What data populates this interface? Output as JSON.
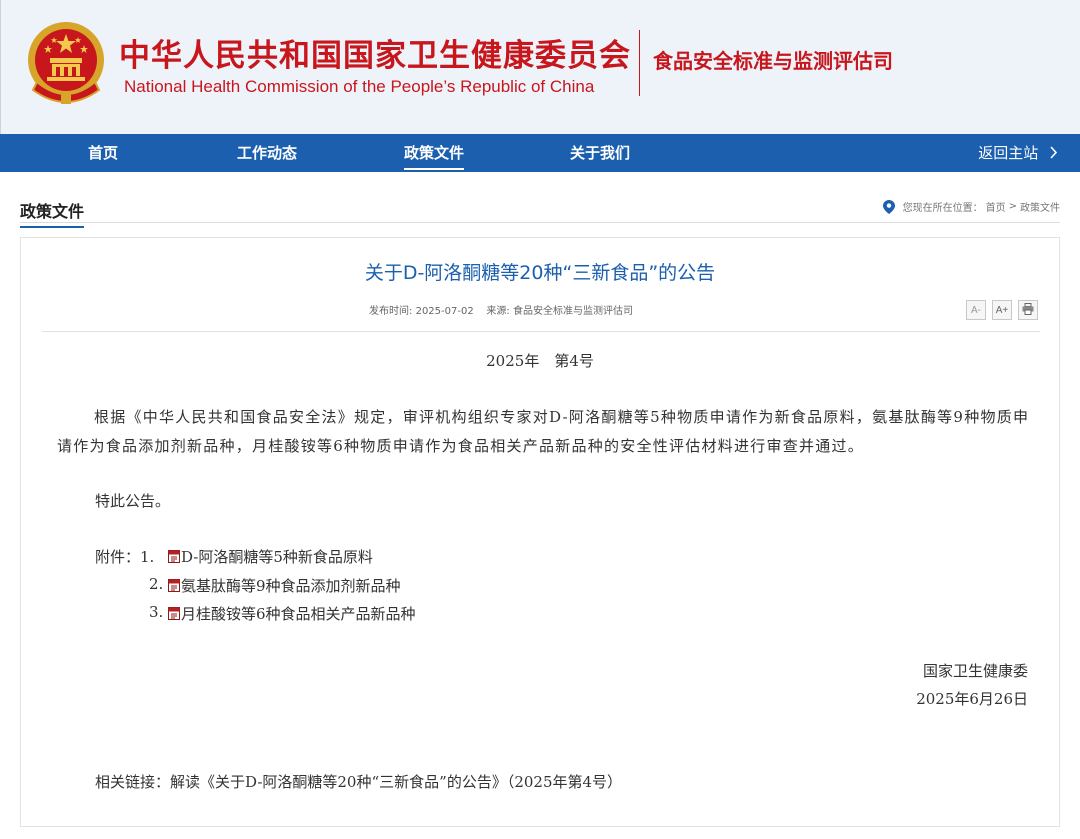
{
  "header": {
    "site_name_cn": "中华人民共和国国家卫生健康委员会",
    "site_name_en": "National Health Commission of the People’s  Republic of China",
    "department": "食品安全标准与监测评估司"
  },
  "nav": {
    "items": [
      {
        "label": "首页",
        "active": false
      },
      {
        "label": "工作动态",
        "active": false
      },
      {
        "label": "政策文件",
        "active": true
      },
      {
        "label": "关于我们",
        "active": false
      }
    ],
    "back_label": "返回主站"
  },
  "section": {
    "title": "政策文件",
    "breadcrumb_prefix": "您现在所在位置：",
    "breadcrumb_home": "首页",
    "breadcrumb_sep": ">",
    "breadcrumb_current": "政策文件"
  },
  "article": {
    "title": "关于D-阿洛酮糖等20种“三新食品”的公告",
    "meta_date_label": "发布时间:",
    "meta_date": "2025-07-02",
    "meta_source_label": "来源:",
    "meta_source": "食品安全标准与监测评估司",
    "tools": {
      "font_smaller": "A-",
      "font_larger": "A+",
      "print": "print-icon"
    },
    "issue": "2025年　第4号",
    "paragraph": "根据《中华人民共和国食品安全法》规定，审评机构组织专家对D-阿洛酮糖等5种物质申请作为新食品原料，氨基肽酶等9种物质申请作为食品添加剂新品种，月桂酸铵等6种物质申请作为食品相关产品新品种的安全性评估材料进行审查并通过。",
    "notice": "特此公告。",
    "attachments_label": "附件：",
    "attachments": [
      {
        "num": "1.",
        "label": "D-阿洛酮糖等5种新食品原料"
      },
      {
        "num": "2.",
        "label": "氨基肽酶等9种食品添加剂新品种"
      },
      {
        "num": "3.",
        "label": "月桂酸铵等6种食品相关产品新品种"
      }
    ],
    "signature_org": "国家卫生健康委",
    "signature_date": "2025年6月26日",
    "related_label": "相关链接：",
    "related_link": "解读《关于D-阿洛酮糖等20种“三新食品”的公告》（2025年第4号）"
  },
  "colors": {
    "brand_red": "#c8161d",
    "nav_blue": "#1b5fae",
    "title_blue": "#1b5fae"
  }
}
